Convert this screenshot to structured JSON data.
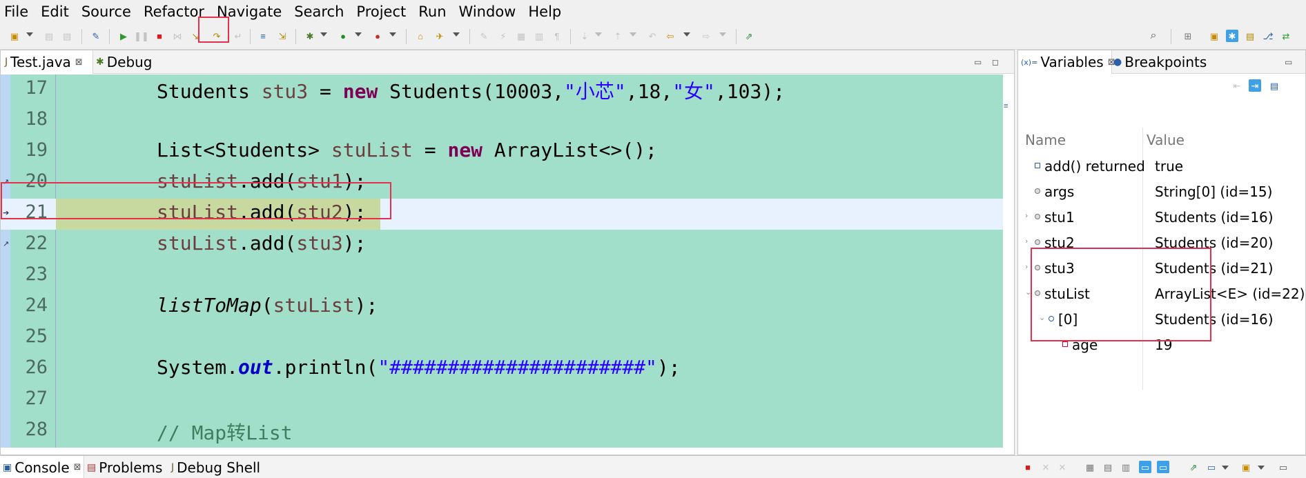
{
  "menu": [
    "File",
    "Edit",
    "Source",
    "Refactor",
    "Navigate",
    "Search",
    "Project",
    "Run",
    "Window",
    "Help"
  ],
  "editor": {
    "tabs": [
      {
        "label": "Test.java",
        "close": "⊠"
      },
      {
        "label": "Debug"
      }
    ],
    "lines": [
      {
        "num": "17"
      },
      {
        "num": "18"
      },
      {
        "num": "19"
      },
      {
        "num": "20"
      },
      {
        "num": "21"
      },
      {
        "num": "22"
      },
      {
        "num": "23"
      },
      {
        "num": "24"
      },
      {
        "num": "25"
      },
      {
        "num": "26"
      },
      {
        "num": "27"
      },
      {
        "num": "28"
      }
    ],
    "code": {
      "l17_a": "Students ",
      "l17_var": "stu3",
      "l17_b": " = ",
      "l17_kw": "new",
      "l17_c": " Students(10003,",
      "l17_s1": "\"小芯\"",
      "l17_d": ",18,",
      "l17_s2": "\"女\"",
      "l17_e": ",103);",
      "l19_a": "List<Students> ",
      "l19_var": "stuList",
      "l19_b": " = ",
      "l19_kw": "new",
      "l19_c": " ArrayList<>();",
      "l20_var": "stuList",
      "l20_a": ".add(",
      "l20_arg": "stu1",
      "l20_b": ");",
      "l21_var": "stuList",
      "l21_a": ".add(",
      "l21_arg": "stu2",
      "l21_b": ");",
      "l22_var": "stuList",
      "l22_a": ".add(",
      "l22_arg": "stu3",
      "l22_b": ");",
      "l24_m": "listToMap",
      "l24_a": "(",
      "l24_var": "stuList",
      "l24_b": ");",
      "l26_a": "System.",
      "l26_fld": "out",
      "l26_b": ".println(",
      "l26_s": "\"######################\"",
      "l26_c": ");",
      "l28_cm": "// Map转List"
    }
  },
  "variables": {
    "tabs": [
      {
        "label": "Variables",
        "close": "⊠"
      },
      {
        "label": "Breakpoints"
      }
    ],
    "headers": {
      "name": "Name",
      "value": "Value"
    },
    "rows": [
      {
        "name": "add() returned",
        "value": "true"
      },
      {
        "name": "args",
        "value": "String[0]  (id=15)"
      },
      {
        "name": "stu1",
        "value": "Students  (id=16)"
      },
      {
        "name": "stu2",
        "value": "Students  (id=20)"
      },
      {
        "name": "stu3",
        "value": "Students  (id=21)"
      },
      {
        "name": "stuList",
        "value": "ArrayList<E>  (id=22)"
      },
      {
        "name": "[0]",
        "value": "Students  (id=16)"
      },
      {
        "name": "age",
        "value": "19"
      }
    ]
  },
  "console": {
    "tabs": [
      {
        "label": "Console",
        "close": "⊠"
      },
      {
        "label": "Problems"
      },
      {
        "label": "Debug Shell"
      }
    ]
  },
  "colors": {
    "editor_bg": "#a2dfca",
    "current_line": "#e8f2fe",
    "highlight_box": "#e4304a",
    "keyword": "#7f0055",
    "string": "#2a00ff"
  }
}
